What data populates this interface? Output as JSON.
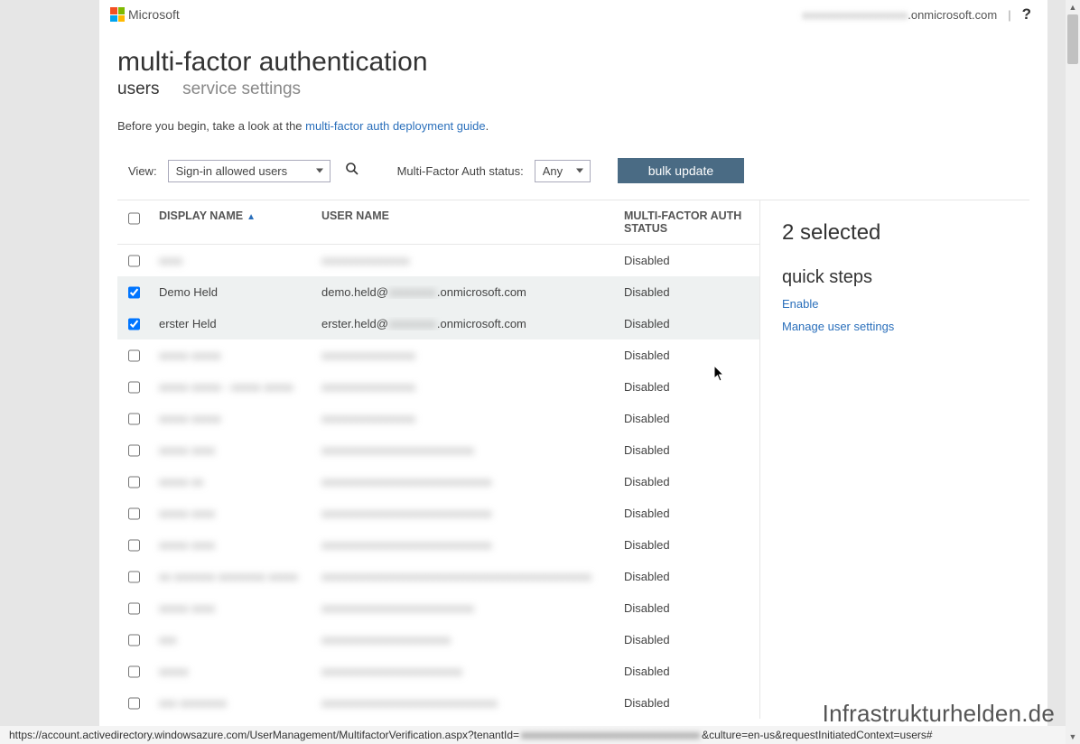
{
  "brand": "Microsoft",
  "account_suffix": ".onmicrosoft.com",
  "help_label": "?",
  "title": "multi-factor authentication",
  "tabs": {
    "users": "users",
    "settings": "service settings"
  },
  "intro_prefix": "Before you begin, take a look at the ",
  "intro_link": "multi-factor auth deployment guide",
  "intro_suffix": ".",
  "filters": {
    "view_label": "View:",
    "view_value": "Sign-in allowed users",
    "status_label": "Multi-Factor Auth status:",
    "status_value": "Any",
    "bulk_label": "bulk update"
  },
  "columns": {
    "name": "DISPLAY NAME",
    "user": "USER NAME",
    "status": "MULTI-FACTOR AUTH STATUS"
  },
  "rows": [
    {
      "checked": false,
      "blurred": true,
      "name": "xxxx",
      "user": "xxxxxxxxxxxxxxx",
      "status": "Disabled"
    },
    {
      "checked": true,
      "blurred": false,
      "name": "Demo Held",
      "user_prefix": "demo.held@",
      "user_suffix": ".onmicrosoft.com",
      "status": "Disabled"
    },
    {
      "checked": true,
      "blurred": false,
      "name": "erster Held",
      "user_prefix": "erster.held@",
      "user_suffix": ".onmicrosoft.com",
      "status": "Disabled"
    },
    {
      "checked": false,
      "blurred": true,
      "name": "xxxxx xxxxx",
      "user": "xxxxxxxxxxxxxxxx",
      "status": "Disabled"
    },
    {
      "checked": false,
      "blurred": true,
      "name": "xxxxx xxxxx - xxxxx xxxxx",
      "user": "xxxxxxxxxxxxxxxx",
      "status": "Disabled"
    },
    {
      "checked": false,
      "blurred": true,
      "name": "xxxxx xxxxx",
      "user": "xxxxxxxxxxxxxxxx",
      "status": "Disabled"
    },
    {
      "checked": false,
      "blurred": true,
      "name": "xxxxx xxxx",
      "user": "xxxxxxxxxxxxxxxxxxxxxxxxxx",
      "status": "Disabled"
    },
    {
      "checked": false,
      "blurred": true,
      "name": "xxxxx xx",
      "user": "xxxxxxxxxxxxxxxxxxxxxxxxxxxxx",
      "status": "Disabled"
    },
    {
      "checked": false,
      "blurred": true,
      "name": "xxxxx xxxx",
      "user": "xxxxxxxxxxxxxxxxxxxxxxxxxxxxx",
      "status": "Disabled"
    },
    {
      "checked": false,
      "blurred": true,
      "name": "xxxxx xxxx",
      "user": "xxxxxxxxxxxxxxxxxxxxxxxxxxxxx",
      "status": "Disabled"
    },
    {
      "checked": false,
      "blurred": true,
      "name": "xx xxxxxxx xxxxxxxx xxxxx",
      "user": "xxxxxxxxxxxxxxxxxxxxxxxxxxxxxxxxxxxxxxxxxxxxxx",
      "status": "Disabled"
    },
    {
      "checked": false,
      "blurred": true,
      "name": "xxxxx xxxx",
      "user": "xxxxxxxxxxxxxxxxxxxxxxxxxx",
      "status": "Disabled"
    },
    {
      "checked": false,
      "blurred": true,
      "name": "xxx",
      "user": "xxxxxxxxxxxxxxxxxxxxxx",
      "status": "Disabled"
    },
    {
      "checked": false,
      "blurred": true,
      "name": "xxxxx",
      "user": "xxxxxxxxxxxxxxxxxxxxxxxx",
      "status": "Disabled"
    },
    {
      "checked": false,
      "blurred": true,
      "name": "xxx xxxxxxxx",
      "user": "xxxxxxxxxxxxxxxxxxxxxxxxxxxxxx",
      "status": "Disabled"
    }
  ],
  "side": {
    "selected": "2 selected",
    "quick": "quick steps",
    "enable": "Enable",
    "manage": "Manage user settings"
  },
  "statusbar_prefix": "https://account.activedirectory.windowsazure.com/UserManagement/MultifactorVerification.aspx?tenantId=",
  "statusbar_suffix": "&culture=en-us&requestInitiatedContext=users#",
  "watermark": "Infrastrukturhelden.de"
}
